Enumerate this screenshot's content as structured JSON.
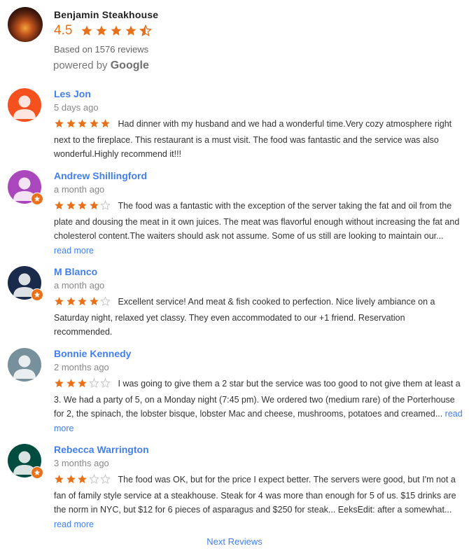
{
  "business": {
    "name": "Benjamin Steakhouse",
    "rating": "4.5",
    "rating_value": 4.5,
    "based_on": "Based on 1576 reviews",
    "powered_by": "powered by",
    "powered_by_brand": "Google"
  },
  "colors": {
    "star": "#e7711b",
    "star_empty": "#bbbbbb",
    "link": "#427fed"
  },
  "reviews": [
    {
      "name": "Les Jon",
      "time": "5 days ago",
      "stars": 5,
      "avatar_color": "#f4511e",
      "local_guide": false,
      "text": "Had dinner with my husband and we had a wonderful time.Very cozy atmosphere right next to the fireplace. This restaurant is a must visit. The food was fantastic and the service was also wonderful.Highly recommend it!!!",
      "read_more": ""
    },
    {
      "name": "Andrew Shillingford",
      "time": "a month ago",
      "stars": 4,
      "avatar_color": "#ab47bc",
      "local_guide": true,
      "text": "The food was a fantastic with the exception of the server taking the fat and oil from the plate and dousing the meat in it own juices.  The meat was flavorful enough without increasing the fat and cholesterol content.The waiters should ask not assume.  Some of us still are looking to maintain our...",
      "read_more": "read more"
    },
    {
      "name": "M Blanco",
      "time": "a month ago",
      "stars": 4,
      "avatar_color": "#1a2a4a",
      "local_guide": true,
      "text": "Excellent service! And meat & fish cooked to perfection. Nice lively ambiance on a Saturday night, relaxed yet classy. They even accommodated to our +1 friend. Reservation recommended.",
      "read_more": ""
    },
    {
      "name": "Bonnie Kennedy",
      "time": "2 months ago",
      "stars": 3,
      "avatar_color": "#78909c",
      "local_guide": false,
      "text": "I was going to give them a 2 star but the service was too good to not give them at least a 3. We had a party of 5, on a Monday night (7:45 pm). We ordered two (medium rare) of the Porterhouse for 2, the spinach, the lobster bisque, lobster Mac and cheese, mushrooms, potatoes and creamed...",
      "read_more": "read more"
    },
    {
      "name": "Rebecca Warrington",
      "time": "3 months ago",
      "stars": 3,
      "avatar_color": "#004d40",
      "local_guide": true,
      "text": "The food was OK, but for the price I expect better. The servers were good, but I'm not a fan of family style service at a steakhouse. Steak for 4 was more than enough for 5 of us. $15 drinks are the norm in NYC, but $12 for 6 pieces of asparagus and $250 for steak... EeksEdit: after a somewhat...",
      "read_more": "read more"
    }
  ],
  "footer": {
    "next_reviews": "Next Reviews"
  }
}
